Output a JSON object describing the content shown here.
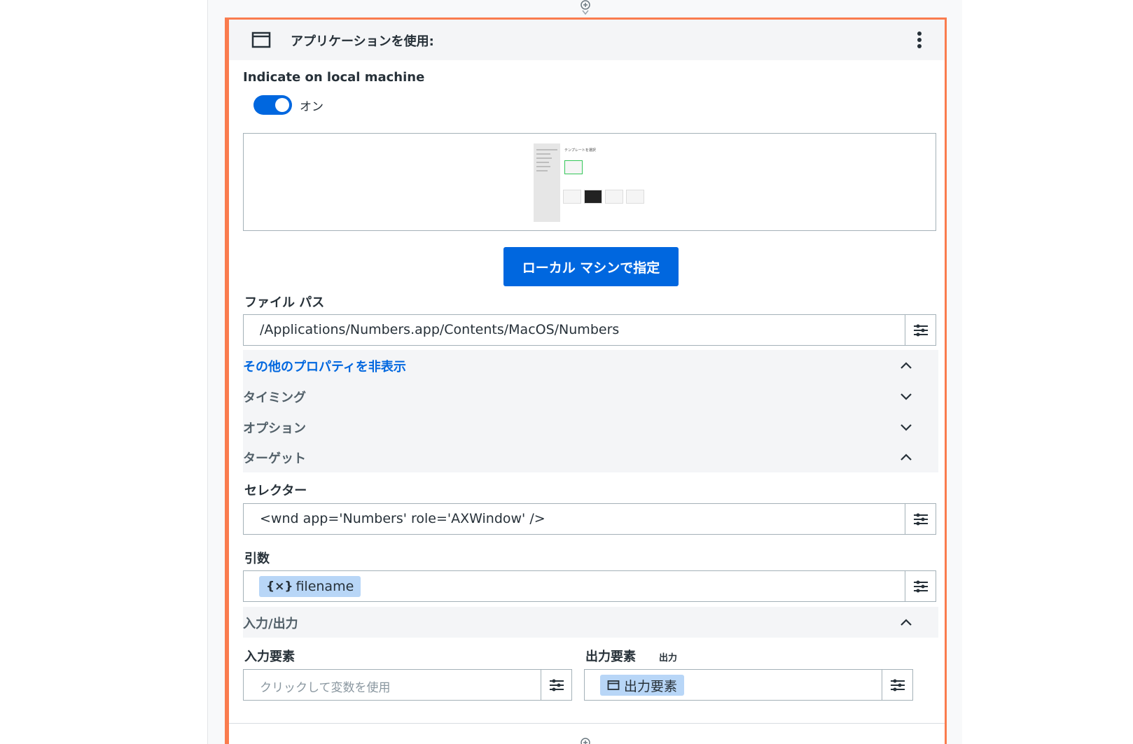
{
  "card": {
    "title": "アプリケーションを使用:",
    "indicate_label": "Indicate on local machine",
    "toggle_state": "オン",
    "indicate_button": "ローカル マシンで指定",
    "preview_caption": "テンプレートを選択"
  },
  "file_path": {
    "label": "ファイル パス",
    "value": "/Applications/Numbers.app/Contents/MacOS/Numbers"
  },
  "sections": {
    "more_properties": "その他のプロパティを非表示",
    "timing": "タイミング",
    "options": "オプション",
    "target": "ターゲット",
    "input_output": "入力/出力"
  },
  "selector": {
    "label": "セレクター",
    "value": "<wnd app='Numbers' role='AXWindow' />"
  },
  "arguments": {
    "label": "引数",
    "chip_icon": "{×}",
    "chip_text": "filename"
  },
  "input_element": {
    "label": "入力要素",
    "placeholder": "クリックして変数を使用"
  },
  "output_element": {
    "label": "出力要素",
    "badge": "出力",
    "chip_text": "出力要素"
  },
  "colors": {
    "accent": "#0067df",
    "card_border": "#fa7c4e",
    "chip_bg": "#b8d6f7"
  },
  "icons": [
    "window-icon",
    "more-vertical-icon",
    "chevron-up-icon",
    "chevron-down-icon",
    "settings-sliders-icon",
    "add-circle-icon"
  ]
}
